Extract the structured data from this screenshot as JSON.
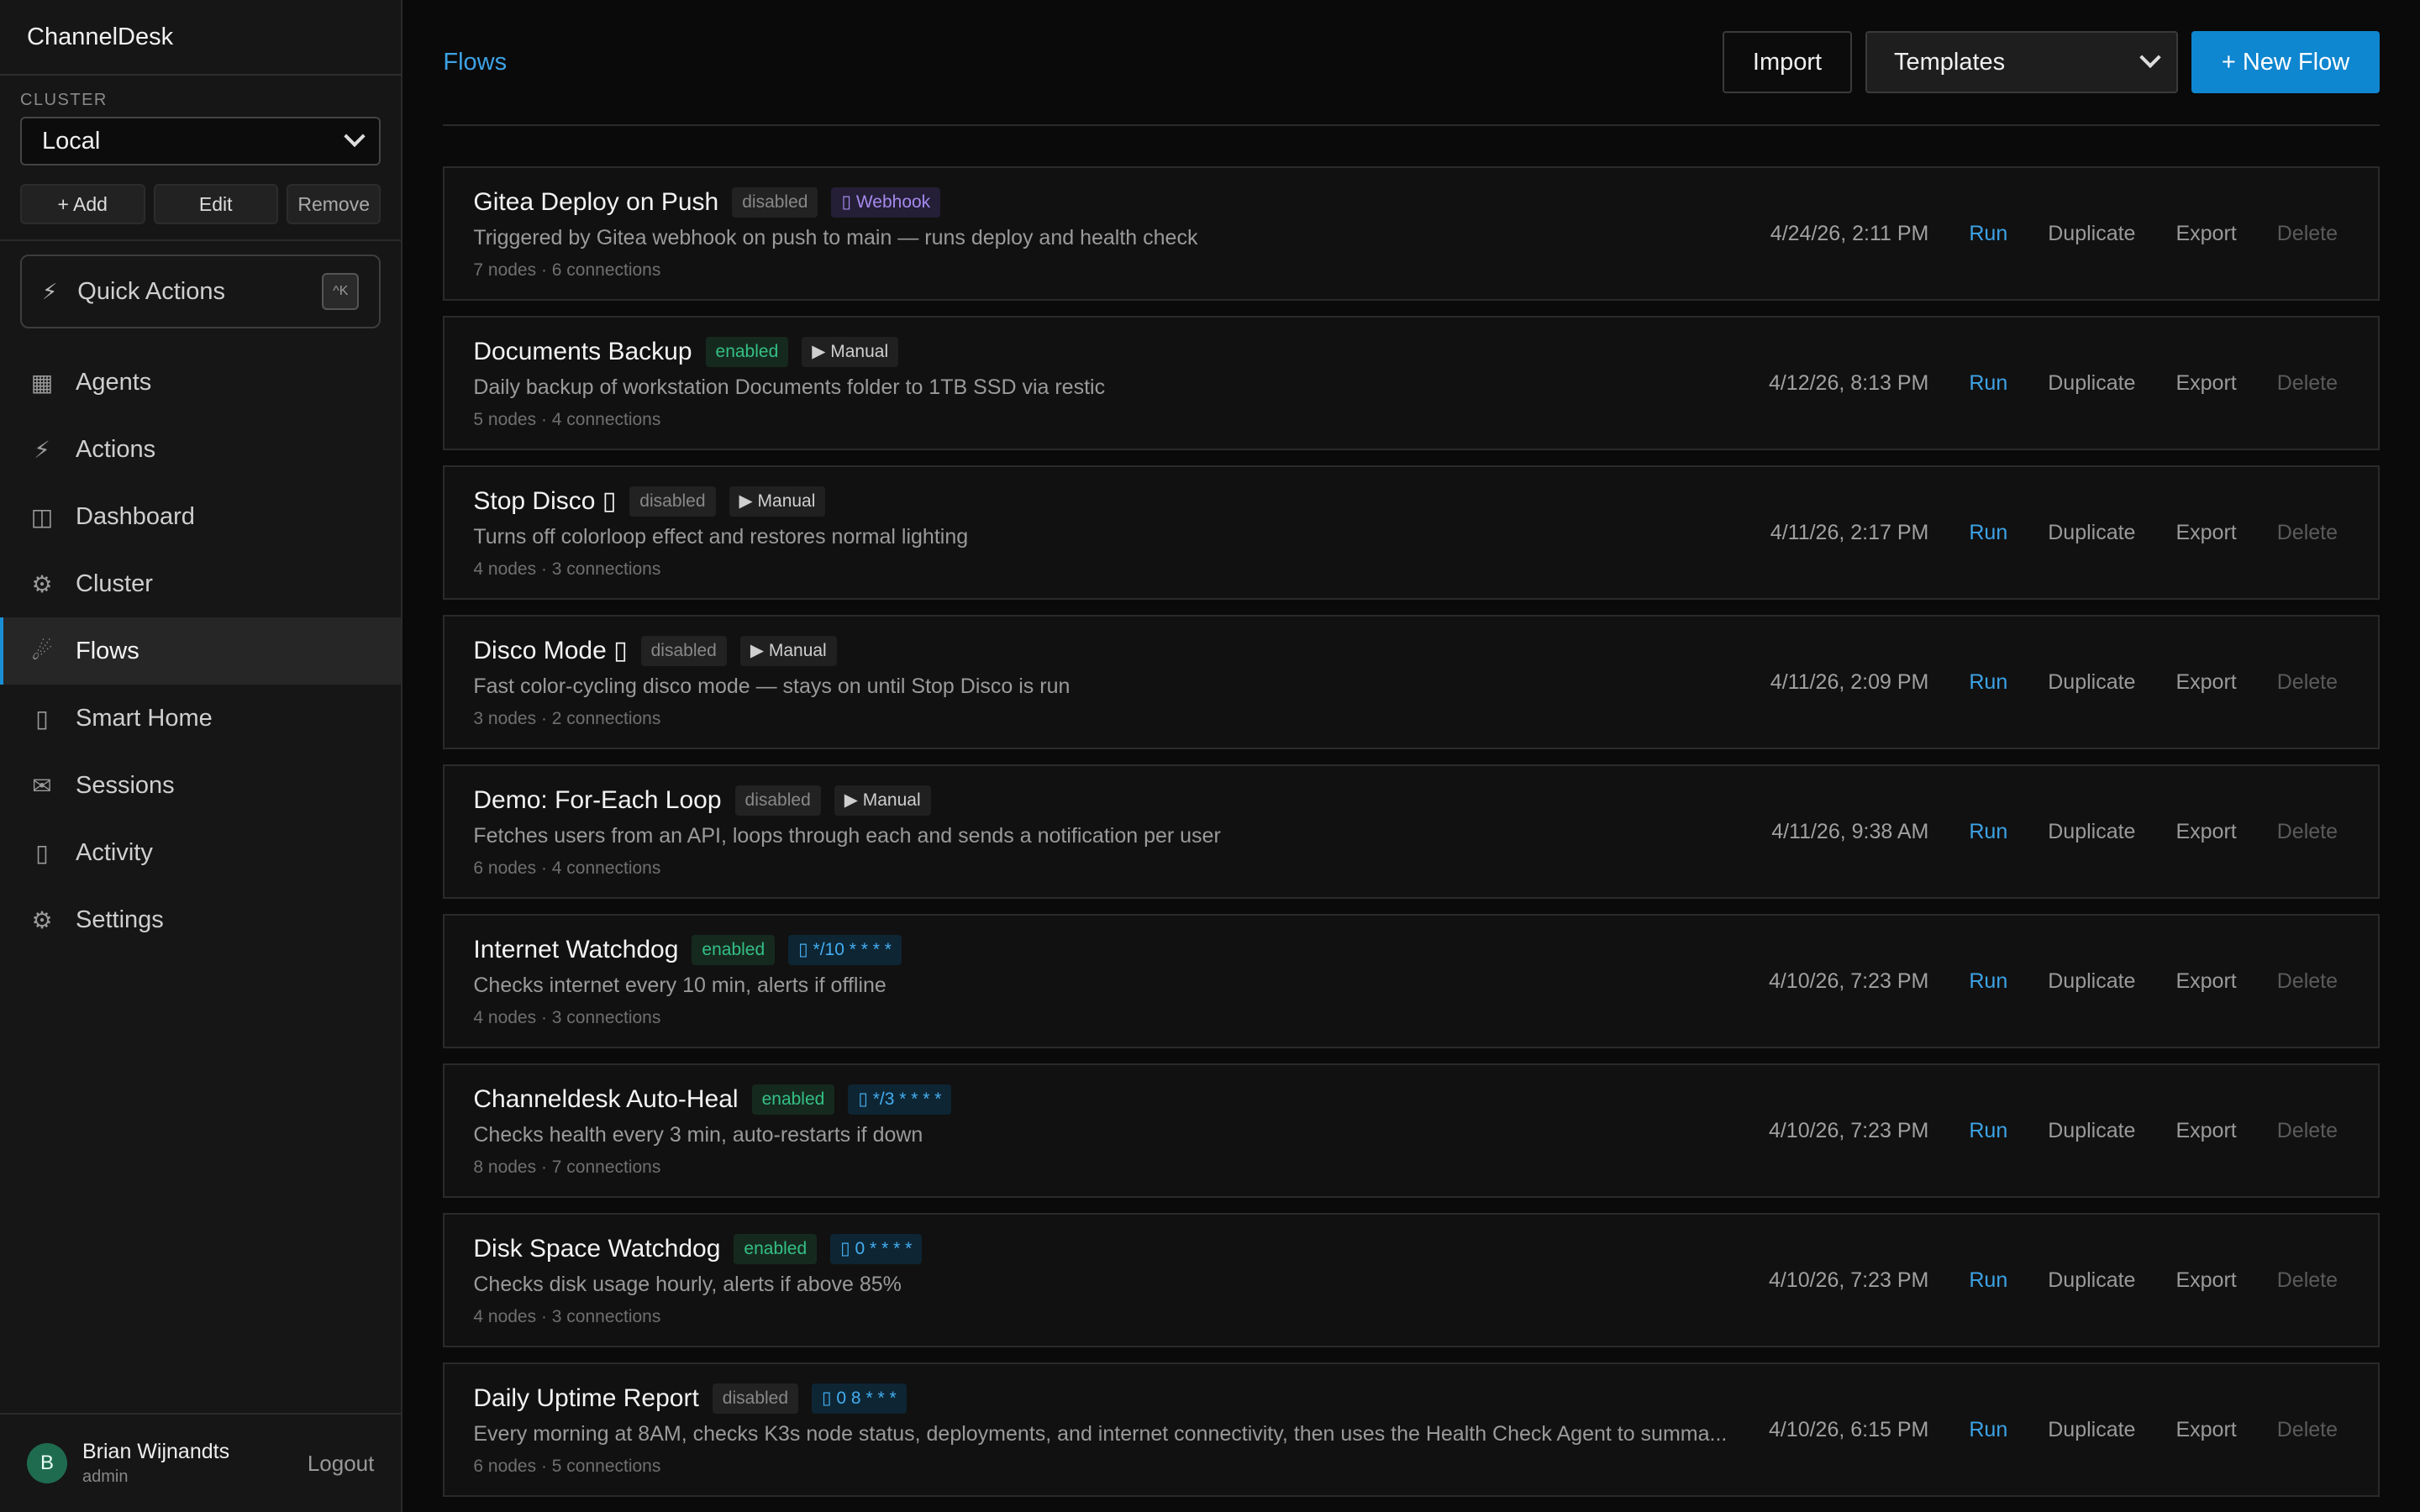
{
  "app": {
    "name": "ChannelDesk"
  },
  "cluster": {
    "label": "CLUSTER",
    "selected": "Local",
    "add_label": "+ Add",
    "edit_label": "Edit",
    "remove_label": "Remove"
  },
  "quick_actions": {
    "label": "Quick Actions",
    "shortcut": "^K"
  },
  "nav": [
    {
      "label": "Agents",
      "icon": "grid-icon",
      "glyph": "▦"
    },
    {
      "label": "Actions",
      "icon": "bolt-icon",
      "glyph": "⚡"
    },
    {
      "label": "Dashboard",
      "icon": "dashboard-icon",
      "glyph": "◫"
    },
    {
      "label": "Cluster",
      "icon": "gear-icon",
      "glyph": "⚙"
    },
    {
      "label": "Flows",
      "icon": "flows-icon",
      "glyph": "☄"
    },
    {
      "label": "Smart Home",
      "icon": "home-icon",
      "glyph": "▯"
    },
    {
      "label": "Sessions",
      "icon": "mail-icon",
      "glyph": "✉"
    },
    {
      "label": "Activity",
      "icon": "activity-icon",
      "glyph": "▯"
    },
    {
      "label": "Settings",
      "icon": "settings-icon",
      "glyph": "⚙"
    }
  ],
  "active_nav": "Flows",
  "user": {
    "initial": "B",
    "name": "Brian Wijnandts",
    "role": "admin",
    "logout_label": "Logout"
  },
  "header": {
    "breadcrumb": "Flows",
    "import_label": "Import",
    "templates_label": "Templates",
    "new_flow_label": "+ New Flow"
  },
  "row_actions": {
    "run": "Run",
    "duplicate": "Duplicate",
    "export": "Export",
    "delete": "Delete"
  },
  "flows": [
    {
      "name": "Gitea Deploy on Push",
      "status": "disabled",
      "trigger": "▯ Webhook",
      "trigger_type": "webhook",
      "description": "Triggered by Gitea webhook on push to main — runs deploy and health check",
      "meta": "7 nodes · 6 connections",
      "date": "4/24/26, 2:11 PM"
    },
    {
      "name": "Documents Backup",
      "status": "enabled",
      "trigger": "▶ Manual",
      "trigger_type": "trigger",
      "description": "Daily backup of workstation Documents folder to 1TB SSD via restic",
      "meta": "5 nodes · 4 connections",
      "date": "4/12/26, 8:13 PM"
    },
    {
      "name": "Stop Disco ▯",
      "status": "disabled",
      "trigger": "▶ Manual",
      "trigger_type": "trigger",
      "description": "Turns off colorloop effect and restores normal lighting",
      "meta": "4 nodes · 3 connections",
      "date": "4/11/26, 2:17 PM"
    },
    {
      "name": "Disco Mode ▯",
      "status": "disabled",
      "trigger": "▶ Manual",
      "trigger_type": "trigger",
      "description": "Fast color-cycling disco mode — stays on until Stop Disco is run",
      "meta": "3 nodes · 2 connections",
      "date": "4/11/26, 2:09 PM"
    },
    {
      "name": "Demo: For-Each Loop",
      "status": "disabled",
      "trigger": "▶ Manual",
      "trigger_type": "trigger",
      "description": "Fetches users from an API, loops through each and sends a notification per user",
      "meta": "6 nodes · 4 connections",
      "date": "4/11/26, 9:38 AM"
    },
    {
      "name": "Internet Watchdog",
      "status": "enabled",
      "trigger": "▯ */10 * * * *",
      "trigger_type": "cron",
      "description": "Checks internet every 10 min, alerts if offline",
      "meta": "4 nodes · 3 connections",
      "date": "4/10/26, 7:23 PM"
    },
    {
      "name": "Channeldesk Auto-Heal",
      "status": "enabled",
      "trigger": "▯ */3 * * * *",
      "trigger_type": "cron",
      "description": "Checks health every 3 min, auto-restarts if down",
      "meta": "8 nodes · 7 connections",
      "date": "4/10/26, 7:23 PM"
    },
    {
      "name": "Disk Space Watchdog",
      "status": "enabled",
      "trigger": "▯ 0 * * * *",
      "trigger_type": "cron",
      "description": "Checks disk usage hourly, alerts if above 85%",
      "meta": "4 nodes · 3 connections",
      "date": "4/10/26, 7:23 PM"
    },
    {
      "name": "Daily Uptime Report",
      "status": "disabled",
      "trigger": "▯ 0 8 * * *",
      "trigger_type": "cron",
      "description": "Every morning at 8AM, checks K3s node status, deployments, and internet connectivity, then uses the Health Check Agent to summa...",
      "meta": "6 nodes · 5 connections",
      "date": "4/10/26, 6:15 PM"
    }
  ]
}
